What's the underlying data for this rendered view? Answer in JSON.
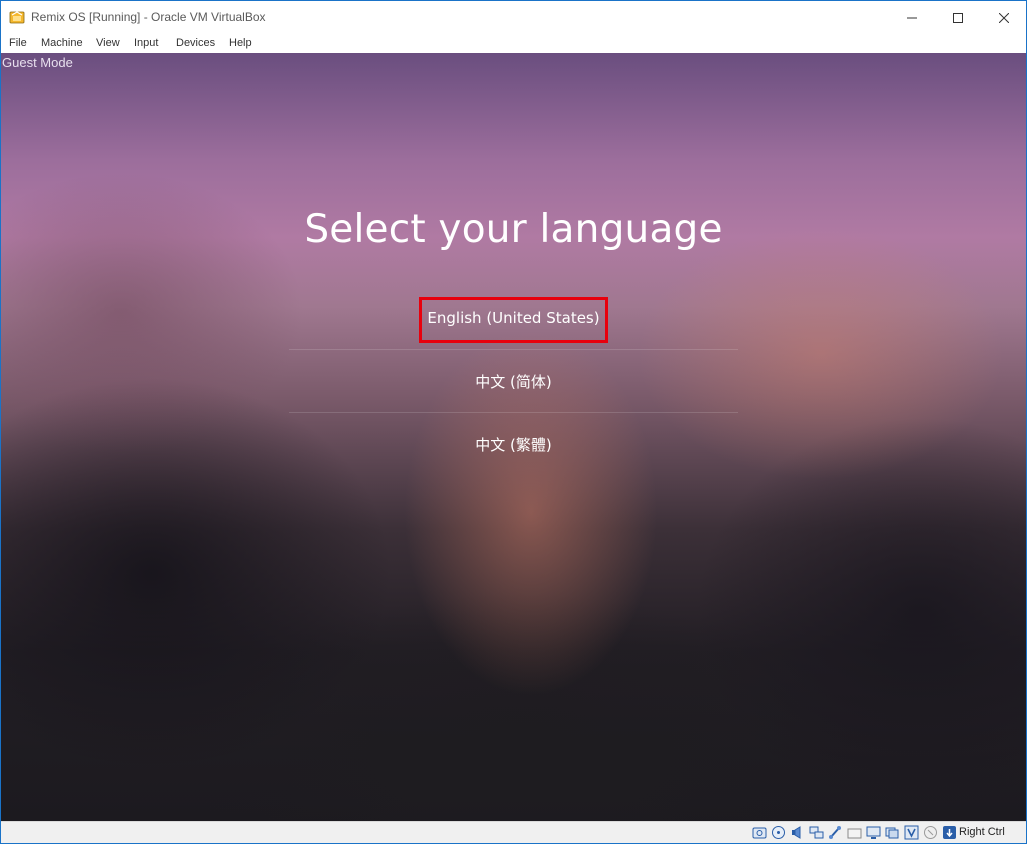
{
  "window": {
    "title": "Remix OS [Running] - Oracle VM VirtualBox",
    "controls": {
      "minimize": "minimize-icon",
      "maximize": "maximize-icon",
      "close": "close-icon"
    }
  },
  "menubar": {
    "items": [
      "File",
      "Machine",
      "View",
      "Input",
      "Devices",
      "Help"
    ]
  },
  "guest": {
    "mode_label": "Guest Mode",
    "heading": "Select your language",
    "languages": [
      "English (United States)",
      "中文 (简体)",
      "中文 (繁體)"
    ],
    "highlighted": "English (United States)",
    "highlight_color": "#e8000d"
  },
  "statusbar": {
    "icons": [
      "hard-disk-icon",
      "optical-drive-icon",
      "audio-icon",
      "network-icon",
      "usb-icon",
      "shared-folders-icon",
      "display-icon",
      "video-capture-icon",
      "virtualization-icon",
      "mouse-integration-icon",
      "keyboard-icon"
    ],
    "host_key": "Right Ctrl"
  },
  "colors": {
    "accent": "#1a73c8",
    "title_text": "#5a5a5a",
    "status_bg": "#f0f0f0"
  }
}
